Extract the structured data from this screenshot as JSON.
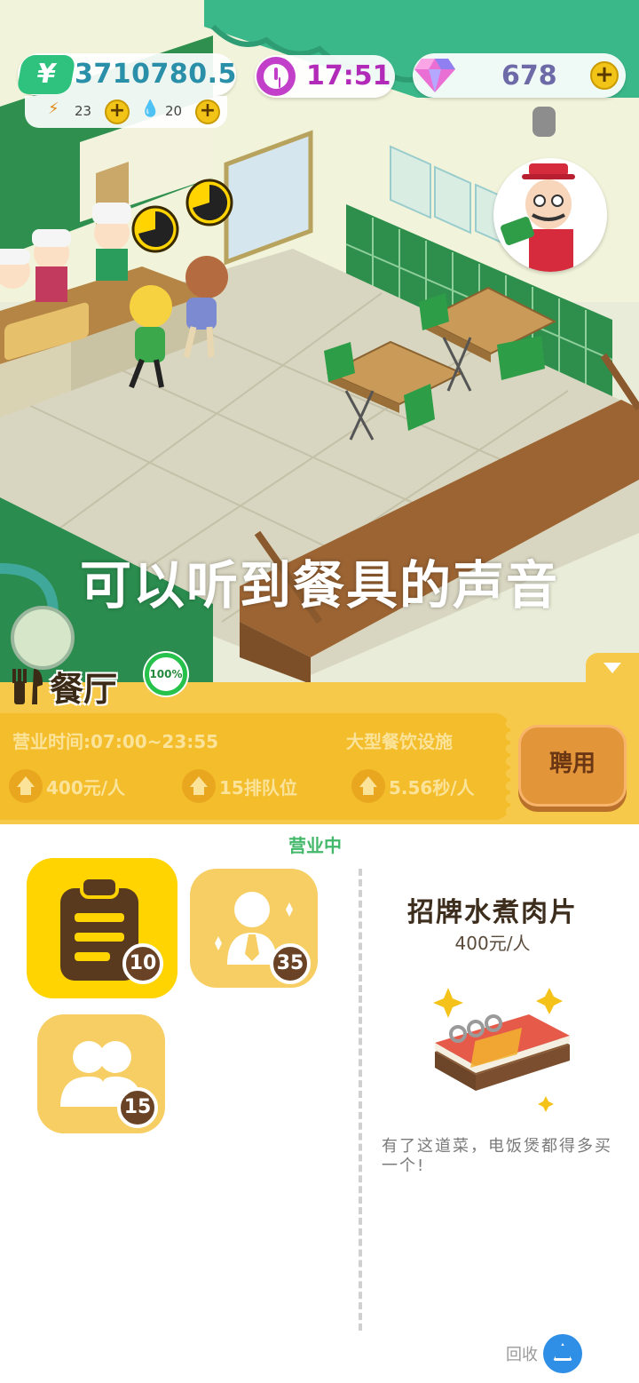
{
  "hud": {
    "money": "3710780.5",
    "energy": "23",
    "water": "20",
    "time": "17:51",
    "gems": "678"
  },
  "subtitle": "可以听到餐具的声音",
  "restaurant": {
    "name": "餐厅",
    "progress": "100%",
    "hours": "营业时间:07:00~23:55",
    "facility": "大型餐饮设施",
    "price_per_person": "400元/人",
    "queue_slots": "15排队位",
    "speed": "5.56秒/人",
    "hire_label": "聘用",
    "status": "营业中"
  },
  "staff_cards": [
    {
      "name": "menu",
      "count": "10"
    },
    {
      "name": "waiter",
      "count": "35"
    },
    {
      "name": "customers",
      "count": "15"
    }
  ],
  "dish": {
    "name": "招牌水煮肉片",
    "price": "400元/人",
    "recipe_book_label": "菜谱",
    "description": "有了这道菜，电饭煲都得多买一个!"
  },
  "recycle_label": "回收",
  "colors": {
    "panel_yellow": "#f6c94a",
    "ticket": "#f3bd2c",
    "accent_green": "#43b86a",
    "hire_orange": "#e3953a"
  },
  "icons": [
    "money-icon",
    "energy-icon",
    "water-icon",
    "clock-icon",
    "gem-icon",
    "plus-icon",
    "utensil-icon",
    "clipboard-icon",
    "waiter-icon",
    "customers-icon",
    "recipe-book-icon",
    "recycle-icon"
  ]
}
